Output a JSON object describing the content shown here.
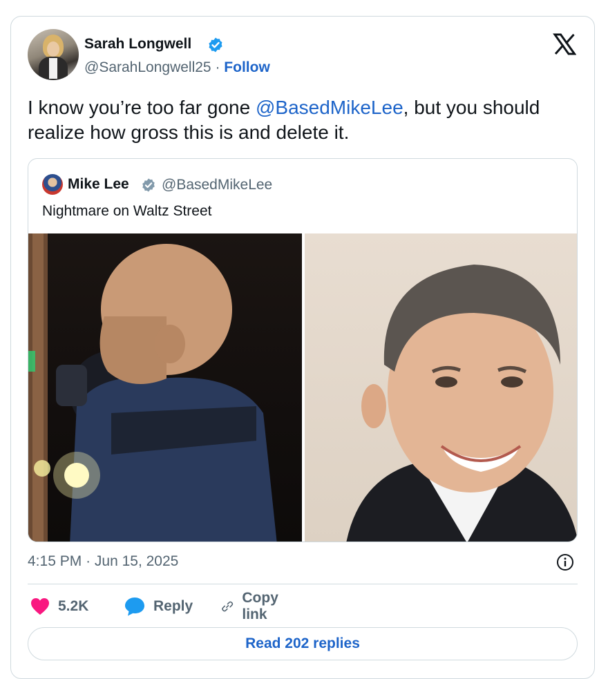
{
  "author": {
    "name": "Sarah Longwell",
    "handle": "@SarahLongwell25",
    "separator": "·",
    "follow_label": "Follow",
    "verified_icon": "verified-badge-icon"
  },
  "tweet": {
    "text_before": "I know you’re too far gone ",
    "mention": "@BasedMikeLee",
    "text_after": ", but you should realize how gross this is and delete it."
  },
  "quoted": {
    "name": "Mike Lee",
    "handle": "@BasedMikeLee",
    "text": "Nightmare on Waltz Street",
    "images": [
      "masked-figure-photo",
      "smiling-man-portrait-photo"
    ]
  },
  "meta": {
    "time": "4:15 PM",
    "separator": "·",
    "date": "Jun 15, 2025"
  },
  "actions": {
    "likes": "5.2K",
    "reply_label": "Reply",
    "copy_link_label": "Copy link"
  },
  "read_replies_label": "Read 202 replies",
  "colors": {
    "link": "#1d64c9",
    "verified": "#1d9bf0",
    "heart": "#f91880",
    "muted": "#536471",
    "border": "#cfd9de"
  }
}
